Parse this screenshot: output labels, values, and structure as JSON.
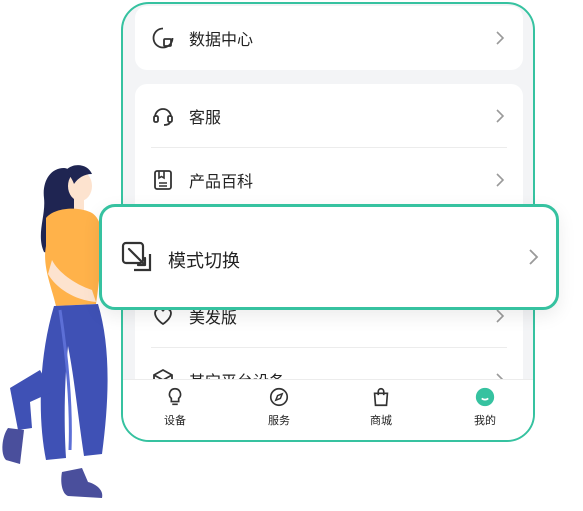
{
  "menu": {
    "data_center_label": "数据中心",
    "customer_service_label": "客服",
    "product_encyclopedia_label": "产品百科",
    "hair_version_label": "美发版",
    "other_platform_label": "其它平台设备"
  },
  "popup": {
    "mode_switch_label": "模式切换"
  },
  "tabbar": {
    "devices_label": "设备",
    "services_label": "服务",
    "mall_label": "商城",
    "mine_label": "我的"
  },
  "colors": {
    "accent": "#36c2a0",
    "background": "#f3f4f6",
    "text": "#222222",
    "chevron": "#9a9a9a"
  },
  "icons": [
    "data-center-icon",
    "headset-icon",
    "book-icon",
    "heart-icon",
    "box-icon",
    "swap-arrows-icon",
    "lightbulb-icon",
    "compass-icon",
    "shopping-bag-icon",
    "mine-icon",
    "chevron-right-icon"
  ]
}
